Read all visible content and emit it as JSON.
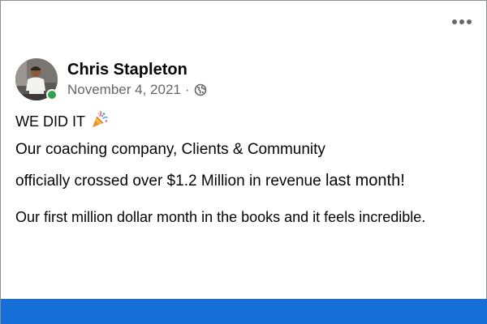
{
  "post": {
    "author": "Chris Stapleton",
    "date": "November 4, 2021",
    "separator": "·",
    "privacy_icon": "globe-icon",
    "more_icon": "more-horizontal-icon",
    "online": true,
    "lines": [
      "WE DID IT",
      "Our coaching company, Clients & Community",
      "officially crossed over $1.2 Million in revenue",
      "last month!",
      "Our first million dollar month in the books and it feels incredible."
    ],
    "emoji_icon": "party-popper-icon"
  },
  "colors": {
    "online_dot": "#31a24c",
    "meta_text": "#65676b",
    "bottom_bar": "#166fd8"
  }
}
